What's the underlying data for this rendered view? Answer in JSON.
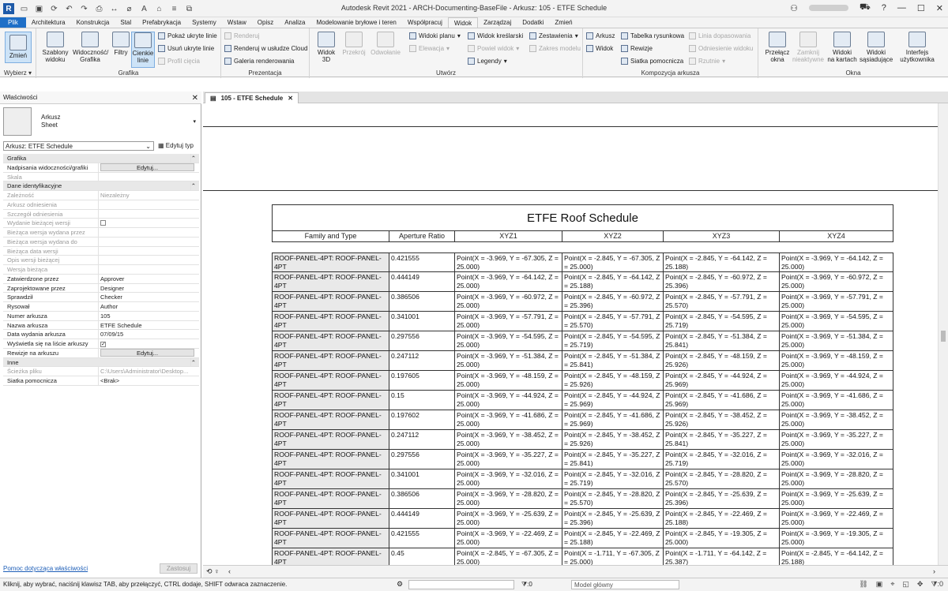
{
  "window": {
    "title": "Autodesk Revit 2021 - ARCH-Documenting-BaseFile - Arkusz: 105 - ETFE Schedule",
    "app_logo": "R"
  },
  "ribbon_tabs": [
    "Plik",
    "Architektura",
    "Konstrukcja",
    "Stal",
    "Prefabrykacja",
    "Systemy",
    "Wstaw",
    "Opisz",
    "Analiza",
    "Modelowanie bryłowe i teren",
    "Współpracuj",
    "Widok",
    "Zarządzaj",
    "Dodatki",
    "Zmień"
  ],
  "active_tab": "Widok",
  "ribbon": {
    "select": {
      "modify": "Zmień",
      "group": "Wybierz ▾"
    },
    "graphics": {
      "templates": "Szablony\nwidoku",
      "visibility": "Widoczność/\nGrafika",
      "filters": "Filtry",
      "thin_lines": "Cienkie\nlinie",
      "show_hidden": "Pokaż ukryte linie",
      "remove_hidden": "Usuń ukryte linie",
      "cut_profile": "Profil cięcia",
      "group": "Grafika"
    },
    "presentation": {
      "render": "Renderuj",
      "render_cloud": "Renderuj w  usłudze Cloud",
      "render_gallery": "Galeria  renderowania",
      "group": "Prezentacja"
    },
    "create": {
      "view3d": "Widok\n3D",
      "section": "Przekrój",
      "callout": "Odwołanie",
      "plan_views": "Widoki planu",
      "elevation": "Elewacja",
      "drafting": "Widok kreślarski",
      "duplicate": "Powiel widok",
      "legends": "Legendy",
      "schedules": "Zestawienia",
      "scope_box": "Zakres modelu",
      "group": "Utwórz"
    },
    "sheet": {
      "sheet": "Arkusz",
      "view": "Widok",
      "title_block": "Tabelka rysunkowa",
      "revisions": "Rewizje",
      "guide_grid": "Siatka pomocnicza",
      "matchline": "Linia dopasowania",
      "view_ref": "Odniesienie widoku",
      "viewports": "Rzutnie",
      "group": "Kompozycja arkusza"
    },
    "windows": {
      "switch": "Przełącz\nokna",
      "close_inactive": "Zamknij\nnieaktywne",
      "tab_views": "Widoki\nna kartach",
      "tile_views": "Widoki\nsąsiadujące",
      "ui": "Interfejs\nużytkownika",
      "group": "Okna"
    }
  },
  "properties": {
    "title": "Właściwości",
    "type_family": "Arkusz",
    "type_name": "Sheet",
    "selector": "Arkusz: ETFE Schedule",
    "edit_type": "Edytuj typ",
    "rows": [
      {
        "kind": "cat",
        "name": "Grafika"
      },
      {
        "name": "Nadpisania widoczności/grafiki",
        "value": "Edytuj...",
        "button": true
      },
      {
        "name": "Skala",
        "value": "",
        "grey": true
      },
      {
        "kind": "cat",
        "name": "Dane identyfikacyjne"
      },
      {
        "name": "Zależność",
        "value": "Niezależny",
        "grey": true
      },
      {
        "name": "Arkusz odniesienia",
        "value": "",
        "grey": true
      },
      {
        "name": "Szczegół odniesienia",
        "value": "",
        "grey": true
      },
      {
        "name": "Wydanie bieżącej wersji",
        "value": "",
        "grey": true,
        "check": ""
      },
      {
        "name": "Bieżąca wersja wydana przez",
        "value": "",
        "grey": true
      },
      {
        "name": "Bieżąca wersja wydana do",
        "value": "",
        "grey": true
      },
      {
        "name": "Bieżąca data wersji",
        "value": "",
        "grey": true
      },
      {
        "name": "Opis wersji bieżącej",
        "value": "",
        "grey": true
      },
      {
        "name": "Wersja bieżąca",
        "value": "",
        "grey": true
      },
      {
        "name": "Zatwierdzone przez",
        "value": "Approver"
      },
      {
        "name": "Zaprojektowane przez",
        "value": "Designer"
      },
      {
        "name": "Sprawdził",
        "value": "Checker"
      },
      {
        "name": "Rysował",
        "value": "Author"
      },
      {
        "name": "Numer arkusza",
        "value": "105"
      },
      {
        "name": "Nazwa arkusza",
        "value": "ETFE Schedule"
      },
      {
        "name": "Data wydania arkusza",
        "value": "07/09/15"
      },
      {
        "name": "Wyświetla się na liście arkuszy",
        "value": "",
        "check": "✓"
      },
      {
        "name": "Rewizje na arkuszu",
        "value": "Edytuj...",
        "button": true
      },
      {
        "kind": "cat",
        "name": "Inne"
      },
      {
        "name": "Ścieżka pliku",
        "value": "C:\\Users\\Administrator\\Desktop...",
        "grey": true
      },
      {
        "name": "Siatka pomocnicza",
        "value": "<Brak>"
      }
    ],
    "help_link": "Pomoc dotycząca właściwości",
    "apply": "Zastosuj"
  },
  "view_tab": {
    "label": "105 - ETFE Schedule"
  },
  "schedule": {
    "title": "ETFE Roof Schedule",
    "headers": [
      "Family and Type",
      "Aperture Ratio",
      "XYZ1",
      "XYZ2",
      "XYZ3",
      "XYZ4"
    ],
    "rows": [
      [
        "ROOF-PANEL-4PT: ROOF-PANEL-4PT",
        "0.421555",
        "Point(X = -3.969, Y = -67.305, Z = 25.000)",
        "Point(X = -2.845, Y = -67.305, Z = 25.000)",
        "Point(X = -2.845, Y = -64.142, Z = 25.188)",
        "Point(X = -3.969, Y = -64.142, Z = 25.000)"
      ],
      [
        "ROOF-PANEL-4PT: ROOF-PANEL-4PT",
        "0.444149",
        "Point(X = -3.969, Y = -64.142, Z = 25.000)",
        "Point(X = -2.845, Y = -64.142, Z = 25.188)",
        "Point(X = -2.845, Y = -60.972, Z = 25.396)",
        "Point(X = -3.969, Y = -60.972, Z = 25.000)"
      ],
      [
        "ROOF-PANEL-4PT: ROOF-PANEL-4PT",
        "0.386506",
        "Point(X = -3.969, Y = -60.972, Z = 25.000)",
        "Point(X = -2.845, Y = -60.972, Z = 25.396)",
        "Point(X = -2.845, Y = -57.791, Z = 25.570)",
        "Point(X = -3.969, Y = -57.791, Z = 25.000)"
      ],
      [
        "ROOF-PANEL-4PT: ROOF-PANEL-4PT",
        "0.341001",
        "Point(X = -3.969, Y = -57.791, Z = 25.000)",
        "Point(X = -2.845, Y = -57.791, Z = 25.570)",
        "Point(X = -2.845, Y = -54.595, Z = 25.719)",
        "Point(X = -3.969, Y = -54.595, Z = 25.000)"
      ],
      [
        "ROOF-PANEL-4PT: ROOF-PANEL-4PT",
        "0.297556",
        "Point(X = -3.969, Y = -54.595, Z = 25.000)",
        "Point(X = -2.845, Y = -54.595, Z = 25.719)",
        "Point(X = -2.845, Y = -51.384, Z = 25.841)",
        "Point(X = -3.969, Y = -51.384, Z = 25.000)"
      ],
      [
        "ROOF-PANEL-4PT: ROOF-PANEL-4PT",
        "0.247112",
        "Point(X = -3.969, Y = -51.384, Z = 25.000)",
        "Point(X = -2.845, Y = -51.384, Z = 25.841)",
        "Point(X = -2.845, Y = -48.159, Z = 25.926)",
        "Point(X = -3.969, Y = -48.159, Z = 25.000)"
      ],
      [
        "ROOF-PANEL-4PT: ROOF-PANEL-4PT",
        "0.197605",
        "Point(X = -3.969, Y = -48.159, Z = 25.000)",
        "Point(X = -2.845, Y = -48.159, Z = 25.926)",
        "Point(X = -2.845, Y = -44.924, Z = 25.969)",
        "Point(X = -3.969, Y = -44.924, Z = 25.000)"
      ],
      [
        "ROOF-PANEL-4PT: ROOF-PANEL-4PT",
        "0.15",
        "Point(X = -3.969, Y = -44.924, Z = 25.000)",
        "Point(X = -2.845, Y = -44.924, Z = 25.969)",
        "Point(X = -2.845, Y = -41.686, Z = 25.969)",
        "Point(X = -3.969, Y = -41.686, Z = 25.000)"
      ],
      [
        "ROOF-PANEL-4PT: ROOF-PANEL-4PT",
        "0.197602",
        "Point(X = -3.969, Y = -41.686, Z = 25.000)",
        "Point(X = -2.845, Y = -41.686, Z = 25.969)",
        "Point(X = -2.845, Y = -38.452, Z = 25.926)",
        "Point(X = -3.969, Y = -38.452, Z = 25.000)"
      ],
      [
        "ROOF-PANEL-4PT: ROOF-PANEL-4PT",
        "0.247112",
        "Point(X = -3.969, Y = -38.452, Z = 25.000)",
        "Point(X = -2.845, Y = -38.452, Z = 25.926)",
        "Point(X = -2.845, Y = -35.227, Z = 25.841)",
        "Point(X = -3.969, Y = -35.227, Z = 25.000)"
      ],
      [
        "ROOF-PANEL-4PT: ROOF-PANEL-4PT",
        "0.297556",
        "Point(X = -3.969, Y = -35.227, Z = 25.000)",
        "Point(X = -2.845, Y = -35.227, Z = 25.841)",
        "Point(X = -2.845, Y = -32.016, Z = 25.719)",
        "Point(X = -3.969, Y = -32.016, Z = 25.000)"
      ],
      [
        "ROOF-PANEL-4PT: ROOF-PANEL-4PT",
        "0.341001",
        "Point(X = -3.969, Y = -32.016, Z = 25.000)",
        "Point(X = -2.845, Y = -32.016, Z = 25.719)",
        "Point(X = -2.845, Y = -28.820, Z = 25.570)",
        "Point(X = -3.969, Y = -28.820, Z = 25.000)"
      ],
      [
        "ROOF-PANEL-4PT: ROOF-PANEL-4PT",
        "0.386506",
        "Point(X = -3.969, Y = -28.820, Z = 25.000)",
        "Point(X = -2.845, Y = -28.820, Z = 25.570)",
        "Point(X = -2.845, Y = -25.639, Z = 25.396)",
        "Point(X = -3.969, Y = -25.639, Z = 25.000)"
      ],
      [
        "ROOF-PANEL-4PT: ROOF-PANEL-4PT",
        "0.444149",
        "Point(X = -3.969, Y = -25.639, Z = 25.000)",
        "Point(X = -2.845, Y = -25.639, Z = 25.396)",
        "Point(X = -2.845, Y = -22.469, Z = 25.188)",
        "Point(X = -3.969, Y = -22.469, Z = 25.000)"
      ],
      [
        "ROOF-PANEL-4PT: ROOF-PANEL-4PT",
        "0.421555",
        "Point(X = -3.969, Y = -22.469, Z = 25.000)",
        "Point(X = -2.845, Y = -22.469, Z = 25.188)",
        "Point(X = -2.845, Y = -19.305, Z = 25.000)",
        "Point(X = -3.969, Y = -19.305, Z = 25.000)"
      ],
      [
        "ROOF-PANEL-4PT: ROOF-PANEL-4PT",
        "0.45",
        "Point(X = -2.845, Y = -67.305, Z = 25.000)",
        "Point(X = -1.711, Y = -67.305, Z = 25.000)",
        "Point(X = -1.711, Y = -64.142, Z = 25.387)",
        "Point(X = -2.845, Y = -64.142, Z = 25.188)"
      ]
    ]
  },
  "statusbar": {
    "message": "Kliknij, aby wybrać, naciśnij klawisz TAB, aby przełączyć, CTRL dodaje, SHIFT odwraca zaznaczenie.",
    "filter_count": ":0",
    "model": "Model główny",
    "selection_count": ":0"
  }
}
